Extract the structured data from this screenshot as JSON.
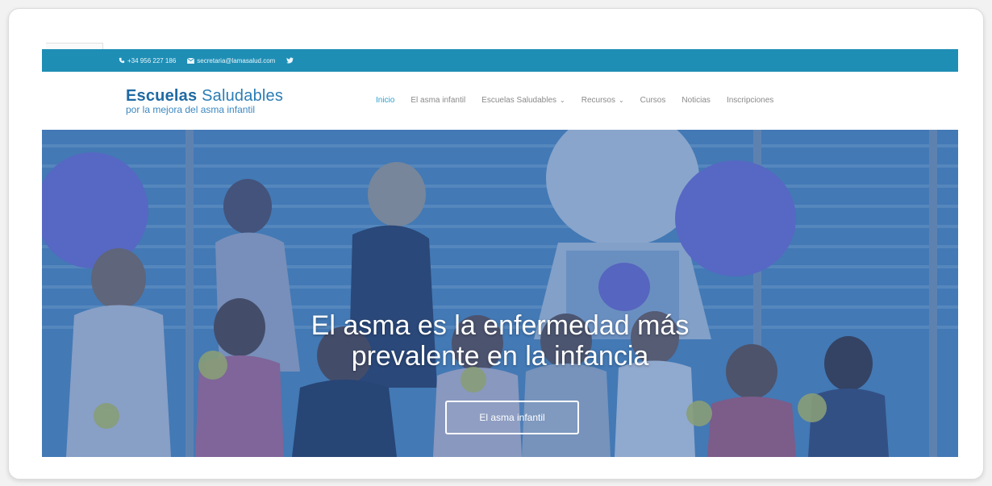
{
  "topbar": {
    "phone": "+34 956 227 186",
    "email": "secretaria@lamasalud.com",
    "social_icon": "twitter-icon",
    "color": "#1f8eb5"
  },
  "logo": {
    "line1_bold": "Escuelas",
    "line1_rest": " Saludables",
    "line2": "por la mejora del asma infantil"
  },
  "nav": {
    "items": [
      {
        "label": "Inicio",
        "active": true
      },
      {
        "label": "El asma infantil",
        "active": false
      },
      {
        "label": "Escuelas Saludables",
        "active": false,
        "dropdown": true
      },
      {
        "label": "Recursos",
        "active": false,
        "dropdown": true
      },
      {
        "label": "Cursos",
        "active": false
      },
      {
        "label": "Noticias",
        "active": false
      },
      {
        "label": "Inscripciones",
        "active": false
      }
    ],
    "active_color": "#2ba1cf"
  },
  "hero": {
    "title_line1": "El asma es la enfermedad más",
    "title_line2": "prevalente en la infancia",
    "button_label": "El asma infantil"
  }
}
